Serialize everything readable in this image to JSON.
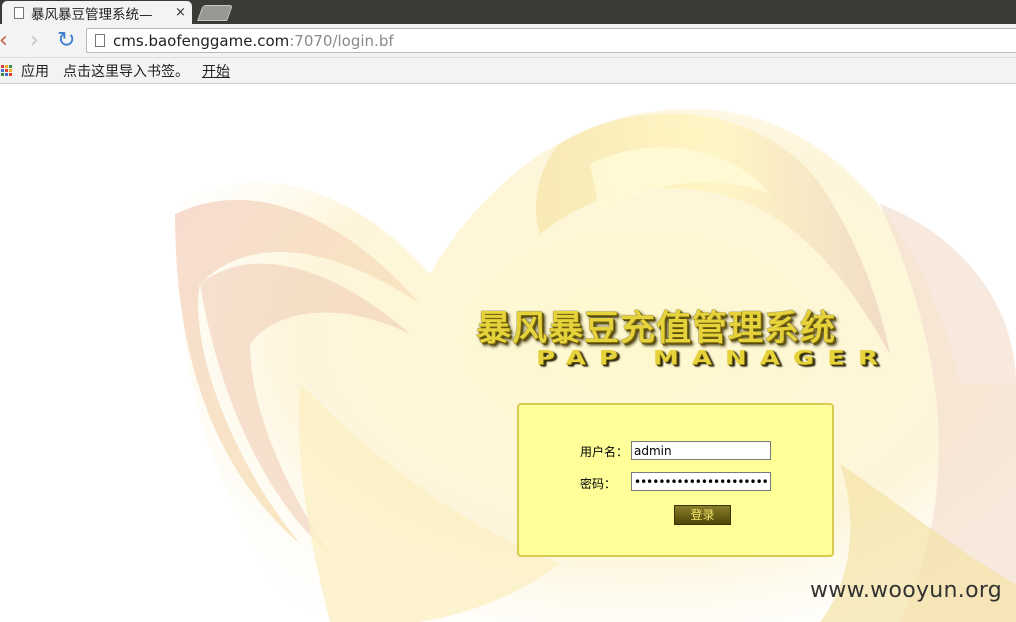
{
  "browser": {
    "tab_title": "暴风暴豆管理系统—",
    "tab_close": "×",
    "url_host": "cms.baofenggame.com",
    "url_rest": ":7070/login.bf",
    "back_icon": "chevron-left-icon",
    "forward_icon": "chevron-right-icon",
    "reload_icon": "reload-icon"
  },
  "bookmarks": {
    "apps_label": "应用",
    "import_label": "点击这里导入书签。",
    "start_label": "开始"
  },
  "page": {
    "title_cn": "暴风暴豆充值管理系统",
    "title_en": "PAP MANAGER",
    "username_label": "用户名：",
    "username_value": "admin",
    "password_label": "密码：",
    "password_value": "••••••••••••••••••••••",
    "login_label": "登录",
    "watermark": "www.wooyun.org"
  },
  "colors": {
    "panel_bg": "#ffff99",
    "panel_border": "#d7cb52",
    "title_gold": "#e6d23a"
  }
}
